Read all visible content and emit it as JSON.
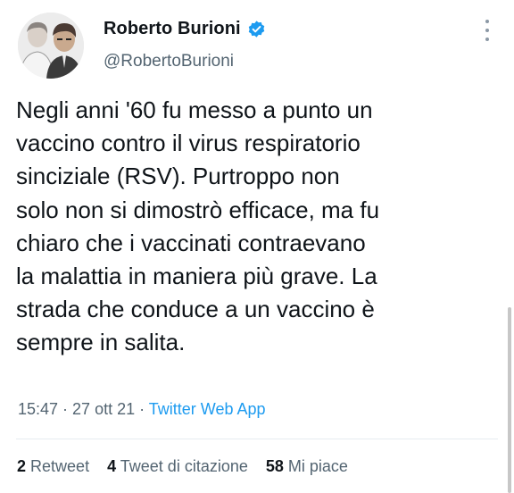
{
  "author": {
    "name": "Roberto Burioni",
    "handle": "@RobertoBurioni",
    "verified_color": "#1d9bf0"
  },
  "tweet": {
    "lines": [
      "Negli anni '60 fu messo a punto un",
      "vaccino contro il virus respiratorio",
      "sinciziale (RSV). Purtroppo non",
      "solo non si dimostrò efficace, ma fu",
      "chiaro che i vaccinati contraevano",
      "la malattia in maniera più grave. La",
      "strada che conduce a un vaccino è",
      "sempre in salita."
    ]
  },
  "meta": {
    "time": "15:47",
    "sep1": " · ",
    "date": "27 ott 21",
    "sep2": " · ",
    "source": "Twitter Web App"
  },
  "stats": {
    "retweets_count": "2",
    "retweets_label": "Retweet",
    "quotes_count": "4",
    "quotes_label": "Tweet di citazione",
    "likes_count": "58",
    "likes_label": "Mi piace"
  },
  "icons": {
    "verified": "verified-badge-icon",
    "more": "more-options-icon"
  }
}
